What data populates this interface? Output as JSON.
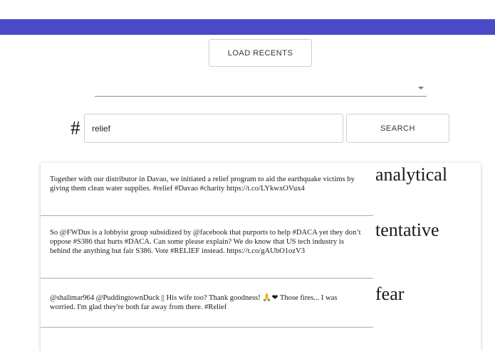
{
  "toolbar": {
    "load_label": "LOAD RECENTS"
  },
  "select": {
    "value": ""
  },
  "search": {
    "hash_symbol": "#",
    "query": "relief",
    "button_label": "SEARCH"
  },
  "tweets": [
    {
      "text": "Together with our distributor in Davao, we initiated a relief program to aid the earthquake victims by giving them clean water supplies. #relief #Davao #charity https://t.co/LYkwxOVux4",
      "tone": "analytical"
    },
    {
      "text": "So @FWDus is a lobbyist group subsidized by @facebook that purports to help #DACA yet they don’t oppose #S386 that hurts #DACA. Can some please explain? We do know that US tech industry is behind the anything but fair S386. Vote #RELIEF instead. https://t.co/gAUbO1ozV3",
      "tone": "tentative"
    },
    {
      "text": "@shalimar964 @PuddingtownDuck || His wife too? Thank goodness! 🙏❤ Those fires... I was worried. I'm glad they're both far away from there. #Relief",
      "tone": "fear"
    }
  ]
}
